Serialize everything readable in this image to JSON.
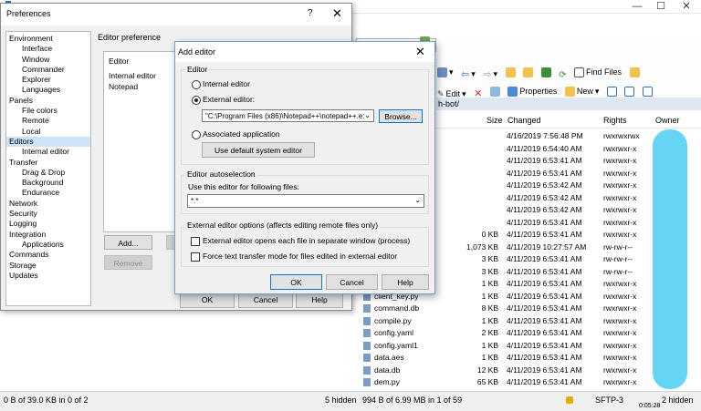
{
  "main": {
    "title": "",
    "toolbar": {
      "find_files": "Find Files",
      "edit": "Edit",
      "properties": "Properties",
      "new": "New"
    },
    "path": "h-bot/",
    "columns": {
      "size": "Size",
      "changed": "Changed",
      "rights": "Rights",
      "owner": "Owner"
    },
    "rows": [
      {
        "name": "",
        "size": "",
        "changed": "4/16/2019 7:56:48 PM",
        "rights": "rwxrwxrwx"
      },
      {
        "name": "",
        "size": "",
        "changed": "4/11/2019 6:54:40 AM",
        "rights": "rwxrwxr-x"
      },
      {
        "name": "",
        "size": "",
        "changed": "4/11/2019 6:53:41 AM",
        "rights": "rwxrwxr-x"
      },
      {
        "name": "",
        "size": "",
        "changed": "4/11/2019 6:53:41 AM",
        "rights": "rwxrwxr-x"
      },
      {
        "name": "",
        "size": "",
        "changed": "4/11/2019 6:53:42 AM",
        "rights": "rwxrwxr-x"
      },
      {
        "name": "",
        "size": "",
        "changed": "4/11/2019 6:53:42 AM",
        "rights": "rwxrwxr-x"
      },
      {
        "name": "",
        "size": "",
        "changed": "4/11/2019 6:53:42 AM",
        "rights": "rwxrwxr-x"
      },
      {
        "name": "",
        "size": "",
        "changed": "4/11/2019 6:53:41 AM",
        "rights": "rwxrwxr-x"
      },
      {
        "name": "",
        "size": "0 KB",
        "changed": "4/11/2019 6:53:41 AM",
        "rights": "rwxrwxr-x"
      },
      {
        "name": "",
        "size": "1,073 KB",
        "changed": "4/11/2019 10:27:57 AM",
        "rights": "rw-rw-r--"
      },
      {
        "name": "",
        "size": "3 KB",
        "changed": "4/11/2019 6:53:41 AM",
        "rights": "rw-rw-r--"
      },
      {
        "name": "",
        "size": "3 KB",
        "changed": "4/11/2019 6:53:41 AM",
        "rights": "rw-rw-r--"
      },
      {
        "name": "",
        "size": "1 KB",
        "changed": "4/11/2019 6:53:41 AM",
        "rights": "rwxrwxr-x"
      },
      {
        "name": "client_key.py",
        "size": "1 KB",
        "changed": "4/11/2019 6:53:41 AM",
        "rights": "rwxrwxr-x"
      },
      {
        "name": "command.db",
        "size": "8 KB",
        "changed": "4/11/2019 6:53:41 AM",
        "rights": "rwxrwxr-x"
      },
      {
        "name": "compile.py",
        "size": "1 KB",
        "changed": "4/11/2019 6:53:41 AM",
        "rights": "rwxrwxr-x"
      },
      {
        "name": "config.yaml",
        "size": "2 KB",
        "changed": "4/11/2019 6:53:41 AM",
        "rights": "rwxrwxr-x"
      },
      {
        "name": "config.yaml1",
        "size": "1 KB",
        "changed": "4/11/2019 6:53:41 AM",
        "rights": "rwxrwxr-x"
      },
      {
        "name": "data.aes",
        "size": "1 KB",
        "changed": "4/11/2019 6:53:41 AM",
        "rights": "rwxrwxr-x"
      },
      {
        "name": "data.db",
        "size": "12 KB",
        "changed": "4/11/2019 6:53:41 AM",
        "rights": "rwxrwxr-x"
      },
      {
        "name": "dem.py",
        "size": "65 KB",
        "changed": "4/11/2019 6:53:41 AM",
        "rights": "rwxrwxr-x"
      }
    ],
    "status": {
      "left": "0 B of 39.0 KB in 0 of 2",
      "left_hidden": "5 hidden",
      "right": "994 B of 6.99 MB in 1 of 59",
      "session": "SFTP-3",
      "time": "0:05:28",
      "right_hidden": "2 hidden"
    }
  },
  "preferences": {
    "title": "Preferences",
    "help_symbol": "?",
    "close_symbol": "✕",
    "tree": [
      {
        "label": "Environment",
        "level": 1
      },
      {
        "label": "Interface",
        "level": 2
      },
      {
        "label": "Window",
        "level": 2
      },
      {
        "label": "Commander",
        "level": 2
      },
      {
        "label": "Explorer",
        "level": 2
      },
      {
        "label": "Languages",
        "level": 2
      },
      {
        "label": "Panels",
        "level": 1
      },
      {
        "label": "File colors",
        "level": 2
      },
      {
        "label": "Remote",
        "level": 2
      },
      {
        "label": "Local",
        "level": 2
      },
      {
        "label": "Editors",
        "level": 1,
        "selected": true
      },
      {
        "label": "Internal editor",
        "level": 2
      },
      {
        "label": "Transfer",
        "level": 1
      },
      {
        "label": "Drag & Drop",
        "level": 2
      },
      {
        "label": "Background",
        "level": 2
      },
      {
        "label": "Endurance",
        "level": 2
      },
      {
        "label": "Network",
        "level": 1
      },
      {
        "label": "Security",
        "level": 1
      },
      {
        "label": "Logging",
        "level": 1
      },
      {
        "label": "Integration",
        "level": 1
      },
      {
        "label": "Applications",
        "level": 2
      },
      {
        "label": "Commands",
        "level": 1
      },
      {
        "label": "Storage",
        "level": 1
      },
      {
        "label": "Updates",
        "level": 1
      }
    ],
    "group_label": "Editor preference",
    "list_header": "Editor",
    "list_items": [
      "Internal editor",
      "Notepad"
    ],
    "add_button": "Add...",
    "remove_button": "Remove",
    "ok_button": "OK",
    "cancel_button": "Cancel",
    "help_button": "Help"
  },
  "add_editor": {
    "title": "Add editor",
    "close_symbol": "✕",
    "group_editor": "Editor",
    "radio_internal": "Internal editor",
    "radio_external": "External editor:",
    "external_path": "\"C:\\Program Files (x86)\\Notepad++\\notepad++.e:",
    "browse_button": "Browse...",
    "radio_associated": "Associated application",
    "system_editor_button": "Use default system editor",
    "group_autoselect": "Editor autoselection",
    "autoselect_label": "Use this editor for following files:",
    "mask_value": "*.*",
    "group_options": "External editor options (affects editing remote files only)",
    "option_separate_window": "External editor opens each file in separate window (process)",
    "option_force_text": "Force text transfer mode for files edited in external editor",
    "ok_button": "OK",
    "cancel_button": "Cancel",
    "help_button": "Help"
  }
}
